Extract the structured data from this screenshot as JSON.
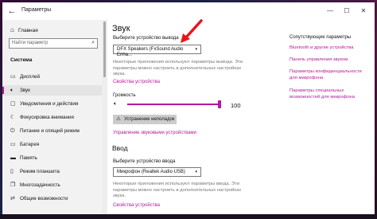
{
  "window": {
    "title": "Параметры",
    "back_glyph": "←",
    "min_glyph": "—",
    "max_glyph": "☐",
    "close_glyph": "✕"
  },
  "sidebar": {
    "home": "Главная",
    "search_placeholder": "Найти параметр",
    "section": "Система",
    "items": [
      {
        "label": "Дисплей",
        "icon": "display-icon"
      },
      {
        "label": "Звук",
        "icon": "sound-icon"
      },
      {
        "label": "Уведомления и действия",
        "icon": "notifications-icon"
      },
      {
        "label": "Фокусировка внимания",
        "icon": "focus-icon"
      },
      {
        "label": "Питание и спящий режим",
        "icon": "power-icon"
      },
      {
        "label": "Батарея",
        "icon": "battery-icon"
      },
      {
        "label": "Память",
        "icon": "storage-icon"
      },
      {
        "label": "Режим планшета",
        "icon": "tablet-icon"
      },
      {
        "label": "Многозадачность",
        "icon": "multitask-icon"
      },
      {
        "label": "Общие возможности",
        "icon": "shared-icon"
      }
    ],
    "active_index": 1
  },
  "main": {
    "title": "Звук",
    "output_label": "Выберите устройство вывода",
    "output_device": "DFX Speakers (FxSound Audio Enha...",
    "output_desc": "Некоторые приложения используют параметры вывода. Эти параметры можно настроить в дополнительных настройках звука.",
    "device_props_link": "Свойства устройства",
    "volume_label": "Громкость",
    "volume_value": "100",
    "volume_level": 1.0,
    "troubleshoot": "Устранение неполадок",
    "manage_devices_link": "Управление звуковыми устройствами",
    "input_title": "Ввод",
    "input_label": "Выберите устройство ввода",
    "input_device": "Микрофон (Realtek Audio USB)",
    "input_desc": "Некоторые приложения используют параметры ввода. Эти параметры можно настроить в дополнительных настройках звука.",
    "input_props_link": "Свойства устройства"
  },
  "related": {
    "title": "Сопутствующие параметры",
    "links": [
      "Bluetooth и другие устройства",
      "Панель управления звуком",
      "Параметры конфиденциальности для микрофона",
      "Параметры специальных возможностей для микрофона"
    ]
  },
  "colors": {
    "accent": "#b5179e",
    "arrow": "#e8141a"
  }
}
